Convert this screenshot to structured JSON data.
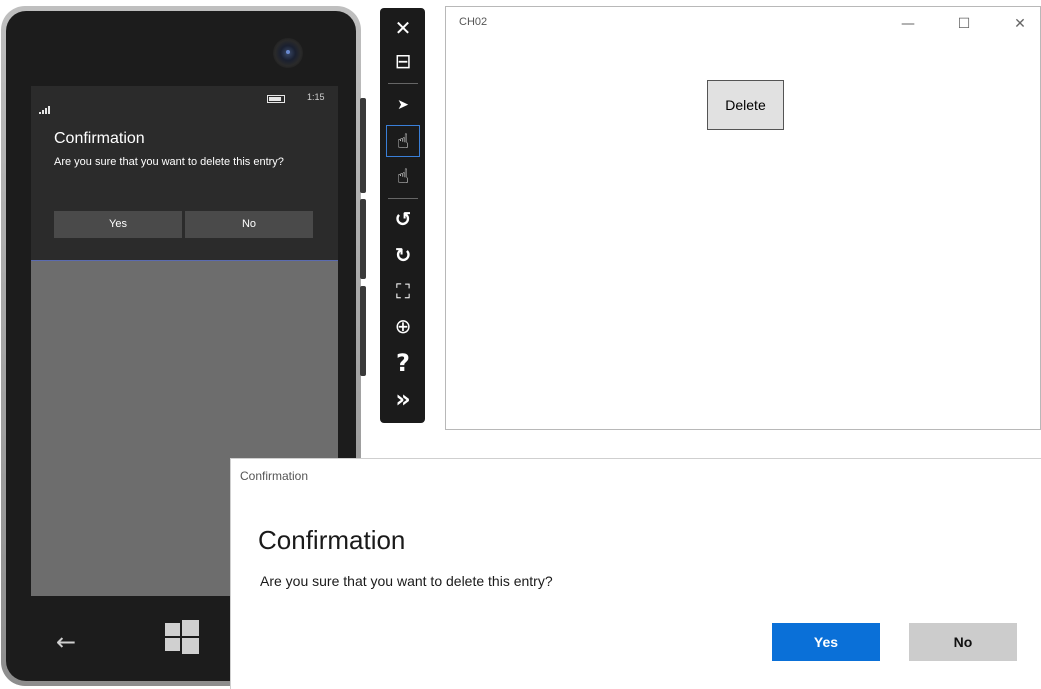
{
  "phone": {
    "status": {
      "time": "1:15"
    },
    "dialog": {
      "title": "Confirmation",
      "message": "Are you sure that you want to delete this entry?",
      "yes_label": "Yes",
      "no_label": "No"
    },
    "nav": {
      "back_icon": "back-arrow-icon",
      "start_icon": "windows-start-icon"
    }
  },
  "toolbar": {
    "items": [
      {
        "icon": "close-icon",
        "glyph": "✕"
      },
      {
        "icon": "minimize-icon",
        "glyph": "⊟"
      },
      {
        "icon": "pointer-icon",
        "glyph": "➤"
      },
      {
        "icon": "single-touch-icon",
        "glyph": "☝"
      },
      {
        "icon": "multi-touch-icon",
        "glyph": "☝"
      },
      {
        "icon": "rotate-left-icon",
        "glyph": "↺"
      },
      {
        "icon": "rotate-right-icon",
        "glyph": "↻"
      },
      {
        "icon": "fit-to-screen-icon",
        "glyph": "⛶"
      },
      {
        "icon": "zoom-icon",
        "glyph": "⊕"
      },
      {
        "icon": "help-icon",
        "glyph": "?"
      },
      {
        "icon": "more-tools-icon",
        "glyph": "»"
      }
    ]
  },
  "window": {
    "title": "CH02",
    "controls": {
      "minimize": "—",
      "maximize": "☐",
      "close": "✕"
    },
    "delete_label": "Delete"
  },
  "dialog": {
    "caption": "Confirmation",
    "title": "Confirmation",
    "message": "Are you sure that you want to delete this entry?",
    "yes_label": "Yes",
    "no_label": "No",
    "colors": {
      "accent": "#0a70d8",
      "secondary": "#cccccc"
    }
  }
}
